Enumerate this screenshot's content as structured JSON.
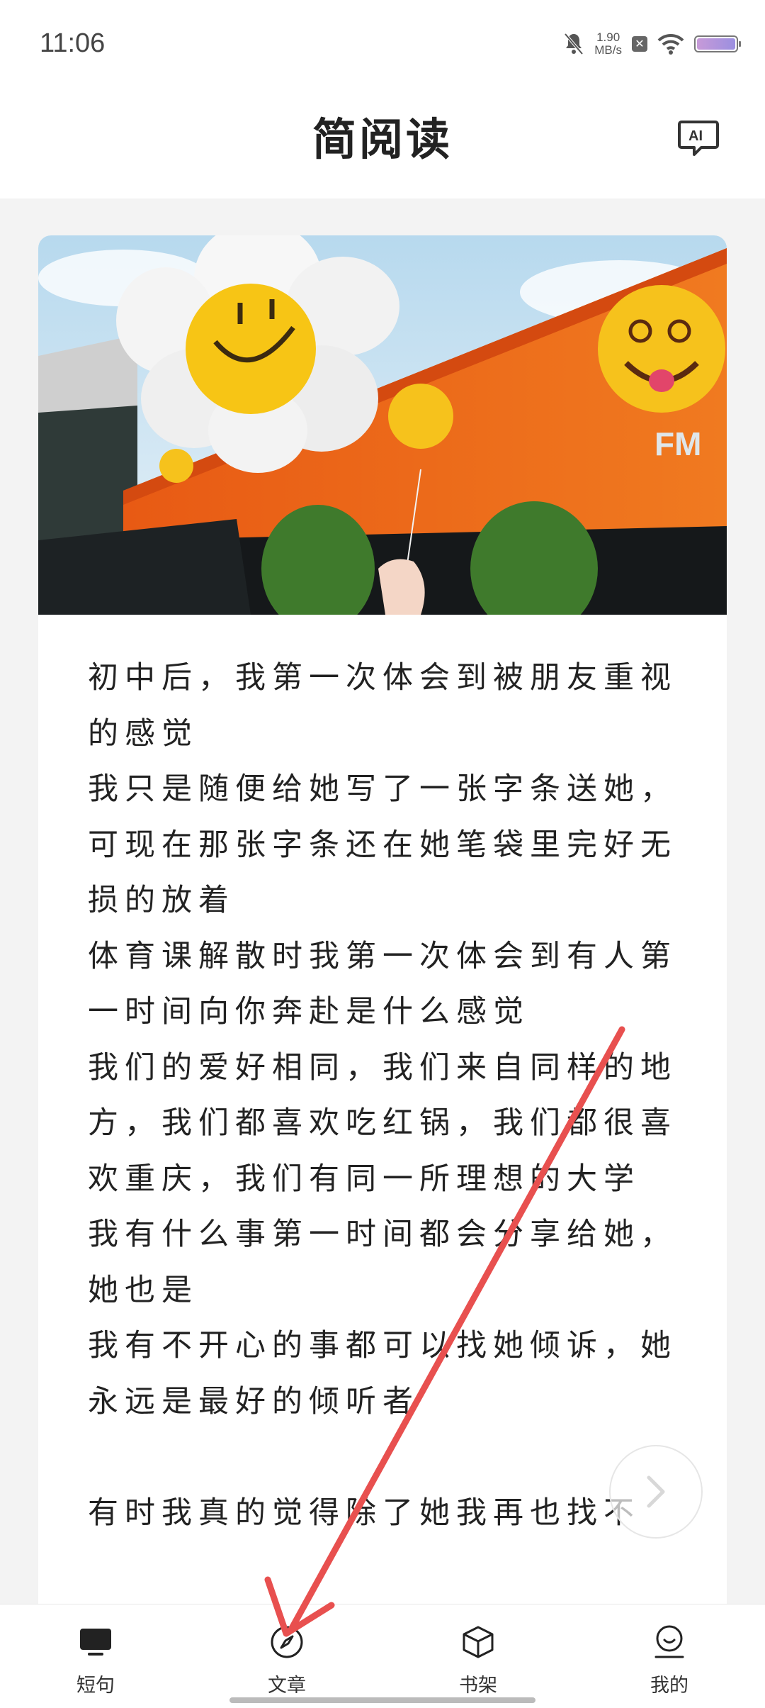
{
  "status_bar": {
    "time": "11:06",
    "net_speed_value": "1.90",
    "net_speed_unit": "MB/s"
  },
  "header": {
    "title": "简阅读",
    "ai_button_icon": "ai-chat-icon"
  },
  "article": {
    "hero_image": "orange building with smiley balloons",
    "body_text": "初中后，我第一次体会到被朋友重视的感觉\n我只是随便给她写了一张字条送她，可现在那张字条还在她笔袋里完好无损的放着\n体育课解散时我第一次体会到有人第一时间向你奔赴是什么感觉\n我们的爱好相同，我们来自同样的地方，我们都喜欢吃红锅，我们都很喜欢重庆，我们有同一所理想的大学\n我有什么事第一时间都会分享给她，她也是\n我有不开心的事都可以找她倾诉，她永远是最好的倾听者\n\n有时我真的觉得除了她我再也找不"
  },
  "next_button_icon": "chevron-right-icon",
  "tabs": [
    {
      "label": "短句",
      "icon": "monitor-icon"
    },
    {
      "label": "文章",
      "icon": "compass-icon"
    },
    {
      "label": "书架",
      "icon": "cube-icon"
    },
    {
      "label": "我的",
      "icon": "profile-icon"
    }
  ],
  "colors": {
    "annotation_arrow": "#e8504f",
    "accent_orange": "#f0701f"
  }
}
